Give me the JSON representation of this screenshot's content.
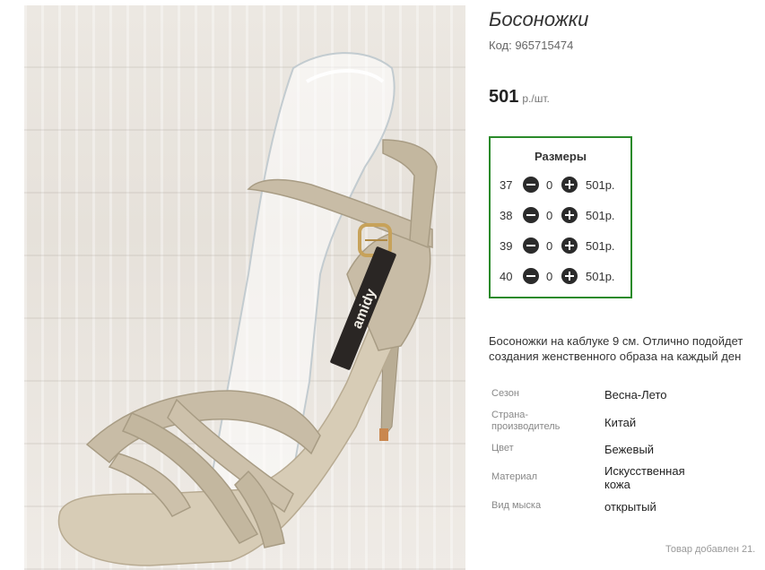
{
  "product": {
    "title": "Босоножки",
    "code": "Код: 965715474",
    "price": {
      "value": "501",
      "unit": "р./шт."
    },
    "image": {
      "brand_print": "amidy"
    }
  },
  "sizes": {
    "title": "Размеры",
    "rows": [
      {
        "size": "37",
        "qty": "0",
        "price": "501р."
      },
      {
        "size": "38",
        "qty": "0",
        "price": "501р."
      },
      {
        "size": "39",
        "qty": "0",
        "price": "501р."
      },
      {
        "size": "40",
        "qty": "0",
        "price": "501р."
      }
    ]
  },
  "description": {
    "line1": "Босоножки на каблуке 9 см. Отлично подойдет",
    "line2": "создания женственного образа на каждый ден"
  },
  "specs": [
    {
      "key": "Сезон",
      "value": "Весна-Лето"
    },
    {
      "key": "Страна-производитель",
      "value": "Китай"
    },
    {
      "key": "Цвет",
      "value": "Бежевый"
    },
    {
      "key": "Материал",
      "value": "Искусственная кожа"
    },
    {
      "key": "Вид мыска",
      "value": "открытый"
    }
  ],
  "footer": {
    "added": "Товар добавлен 21."
  },
  "colors": {
    "accent_border": "#2a8a2a",
    "sandal": "#c8bca6",
    "buckle": "#c7a25a"
  }
}
